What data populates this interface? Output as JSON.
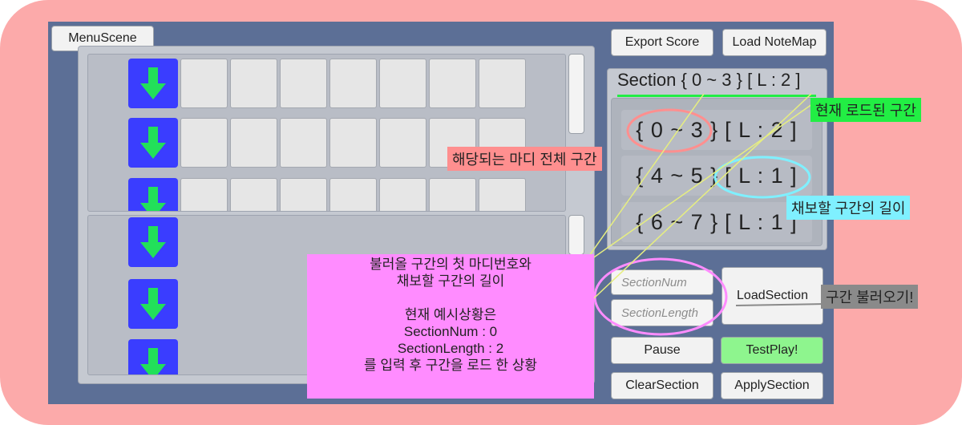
{
  "buttons": {
    "menu_scene": "MenuScene",
    "export_score": "Export Score",
    "load_notemap": "Load NoteMap",
    "load_section": "LoadSection",
    "pause": "Pause",
    "test_play": "TestPlay!",
    "clear_section": "ClearSection",
    "apply_section": "ApplySection"
  },
  "section_header": "Section { 0 ~ 3 } [ L : 2 ]",
  "sections": [
    {
      "range": "{ 0 ~ 3 }",
      "length": "[ L : 2 ]"
    },
    {
      "range": "{ 4 ~ 5 }",
      "length": "[ L : 1 ]"
    },
    {
      "range": "{ 6 ~ 7 }",
      "length": "[ L : 1 ]"
    }
  ],
  "inputs": {
    "section_num_placeholder": "SectionNum",
    "section_length_placeholder": "SectionLength"
  },
  "annotations": {
    "current_loaded": "현재 로드된 구간",
    "full_range": "해당되는 마디 전체 구간",
    "length_to_chart": "채보할 구간의 길이",
    "load_section": "구간 불러오기!",
    "explanation": [
      "불러올 구간의 첫 마디번호와",
      "채보할 구간의 길이",
      "",
      "현재 예시상황은",
      "SectionNum : 0",
      "SectionLength : 2",
      "를 입력 후 구간을 로드 한 상황"
    ]
  },
  "colors": {
    "background": "#fcaaaa",
    "screen": "#5c6f96",
    "arrow_box": "#3a3dff",
    "arrow": "#22e05a",
    "test_play": "#8ef58e",
    "annotation_green": "#22ee44",
    "annotation_red": "#ff8f8f",
    "annotation_cyan": "#7ff0ff",
    "annotation_pink": "#ff8cff",
    "annotation_gray": "#8a8a8a"
  },
  "icons": {
    "arrow": "arrow-down-icon"
  }
}
